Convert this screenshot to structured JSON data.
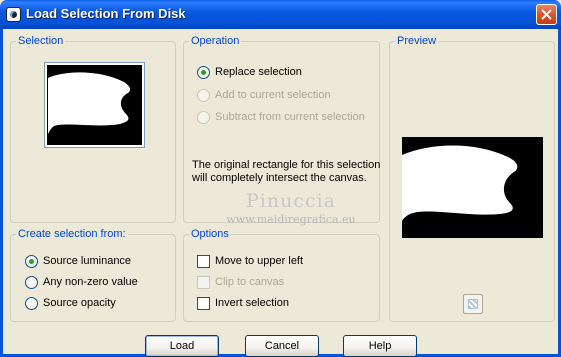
{
  "window": {
    "title": "Load Selection From Disk",
    "close_icon": "close-icon"
  },
  "selection": {
    "title": "Selection"
  },
  "operation": {
    "title": "Operation",
    "options": [
      {
        "label": "Replace selection",
        "checked": true,
        "enabled": true
      },
      {
        "label": "Add to current selection",
        "checked": false,
        "enabled": false
      },
      {
        "label": "Subtract from current selection",
        "checked": false,
        "enabled": false
      }
    ],
    "info_line1": "The original rectangle for this selection",
    "info_line2": "will completely intersect the canvas."
  },
  "watermark": {
    "name": "Pinuccia",
    "url": "www.maidiregrafica.eu"
  },
  "preview": {
    "title": "Preview"
  },
  "create_from": {
    "title": "Create selection from:",
    "options": [
      {
        "label": "Source luminance",
        "checked": true
      },
      {
        "label": "Any non-zero value",
        "checked": false
      },
      {
        "label": "Source opacity",
        "checked": false
      }
    ]
  },
  "options": {
    "title": "Options",
    "items": [
      {
        "label": "Move to upper left",
        "checked": false,
        "enabled": true
      },
      {
        "label": "Clip to canvas",
        "checked": false,
        "enabled": false
      },
      {
        "label": "Invert selection",
        "checked": false,
        "enabled": true
      }
    ]
  },
  "buttons": {
    "load": "Load",
    "cancel": "Cancel",
    "help": "Help"
  },
  "colors": {
    "title_bar": "#0453d8",
    "group_title": "#0046d5",
    "dialog_bg": "#ece9d8"
  }
}
